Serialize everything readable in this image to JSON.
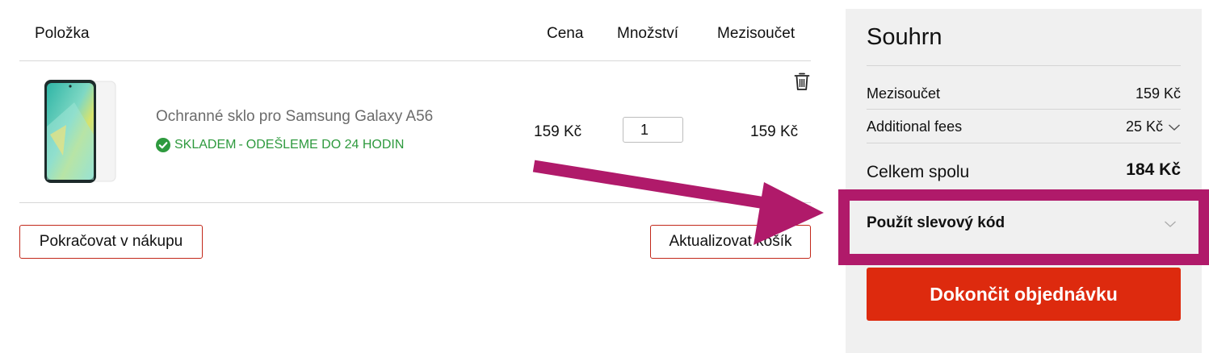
{
  "cart": {
    "headers": {
      "item": "Položka",
      "price": "Cena",
      "quantity": "Množství",
      "subtotal": "Mezisoučet"
    },
    "items": [
      {
        "name": "Ochranné sklo pro Samsung Galaxy A56",
        "stock_status": "SKLADEM",
        "separator": "-",
        "shipping_note": "ODEŠLEME DO 24 HODIN",
        "price": "159 Kč",
        "quantity": "1",
        "subtotal": "159 Kč",
        "image_icon": "phone-screen-protector-image",
        "remove_icon": "trash-icon"
      }
    ],
    "continue_label": "Pokračovat v nákupu",
    "update_label": "Aktualizovat košík"
  },
  "summary": {
    "title": "Souhrn",
    "subtotal_label": "Mezisoučet",
    "subtotal_value": "159 Kč",
    "fees_label": "Additional fees",
    "fees_value": "25 Kč",
    "total_label": "Celkem spolu",
    "total_value": "184 Kč",
    "coupon_label": "Použít slevový kód",
    "checkout_label": "Dokončit objednávku"
  },
  "colors": {
    "accent_red": "#dd2a0e",
    "outline_red": "#c2281a",
    "stock_green": "#2e9a3e",
    "annotation_magenta": "#b01a6a",
    "summary_bg": "#f0f0f0"
  }
}
